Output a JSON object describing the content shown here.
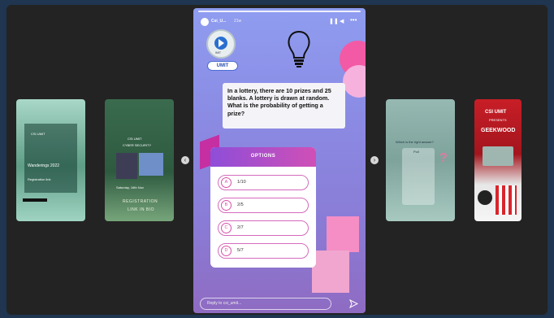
{
  "main_story": {
    "account_name": "Csi_U...",
    "time_ago": "21w",
    "badge_text": "IMIT",
    "button_label": "UMIT",
    "question": "In a lottery, there are 10 prizes and 25 blanks. A lottery is drawn at random. What is the probability of getting a prize?",
    "options_title": "OPTIONS",
    "options": [
      {
        "letter": "A",
        "text": "1/10"
      },
      {
        "letter": "B",
        "text": "2/5"
      },
      {
        "letter": "C",
        "text": "2/7"
      },
      {
        "letter": "D",
        "text": "5/7"
      }
    ],
    "reply_placeholder": "Reply to csi_umit..."
  },
  "side_stories": {
    "story1": {
      "lines": [
        "CSI UMIT",
        "Wanderings 2022",
        "Registration link"
      ]
    },
    "story2": {
      "header": "CSI UMIT",
      "subheader": "CYBER SECURITY",
      "caption": "Saturday, 16th Nov",
      "registration": "REGISTRATION",
      "link": "LINK IN BIO"
    },
    "story4": {
      "title": "Poll",
      "lines": [
        "Which is the right answer?"
      ]
    },
    "story5": {
      "brand": "CSI UMIT",
      "presents": "PRESENTS",
      "title": "GEEKWOOD"
    }
  },
  "colors": {
    "page_bg": "#1f3550",
    "viewer_bg": "#232323",
    "accent_pink": "#d94fa8",
    "accent_purple": "#8e4ed8"
  },
  "icons": {
    "lightbulb": "lightbulb-icon",
    "pause": "pause-icon",
    "mute": "volume-icon",
    "more": "more-icon",
    "send": "send-icon",
    "prev": "chevron-left-icon",
    "next": "chevron-right-icon"
  }
}
